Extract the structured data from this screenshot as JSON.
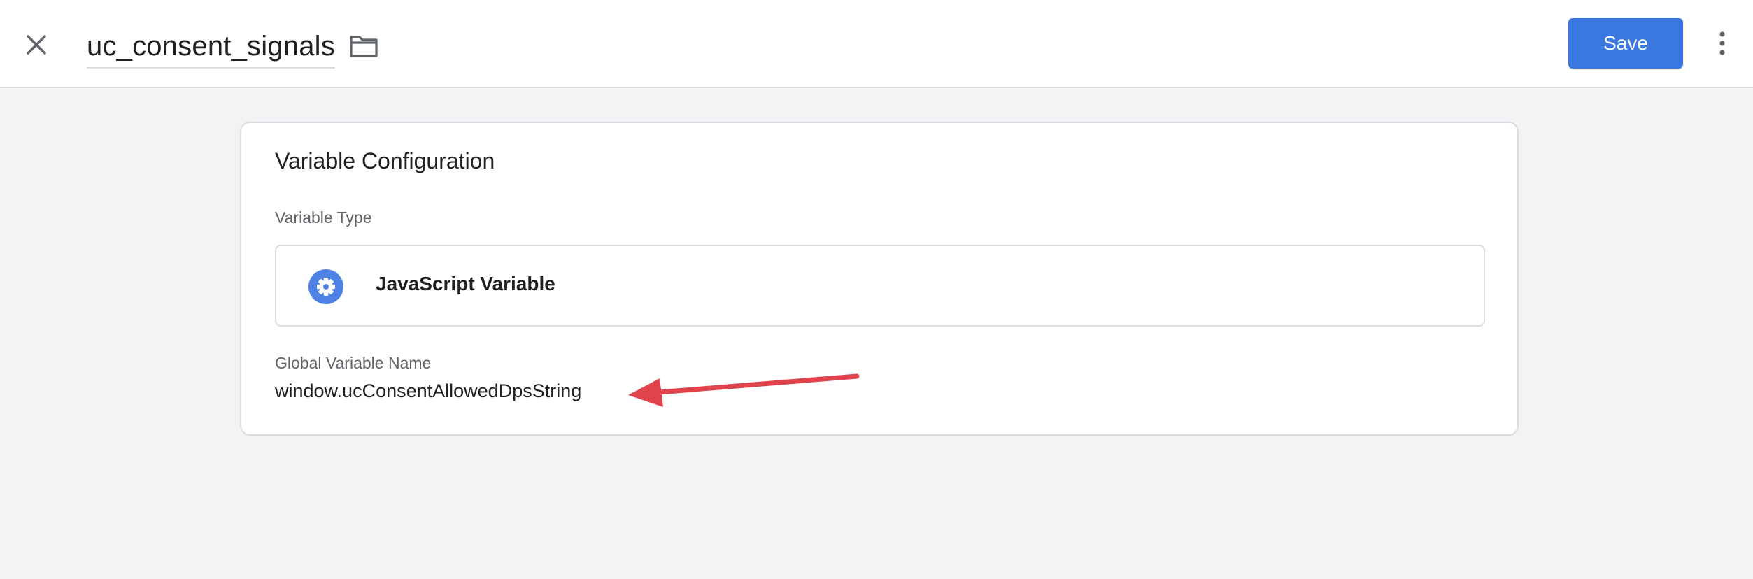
{
  "header": {
    "title": "uc_consent_signals",
    "save_label": "Save",
    "icons": {
      "close": "close-icon",
      "folder": "folder-icon",
      "more": "more-vert-icon"
    }
  },
  "card": {
    "title": "Variable Configuration",
    "variable_type_label": "Variable Type",
    "variable_type_value": "JavaScript Variable",
    "variable_type_icon": "gear-icon",
    "global_variable_label": "Global Variable Name",
    "global_variable_value": "window.ucConsentAllowedDpsString"
  },
  "colors": {
    "primary": "#3a78e0",
    "gear_bg": "#4e83e5",
    "annotation_arrow": "#e0434b",
    "background": "#f1f3f4"
  }
}
